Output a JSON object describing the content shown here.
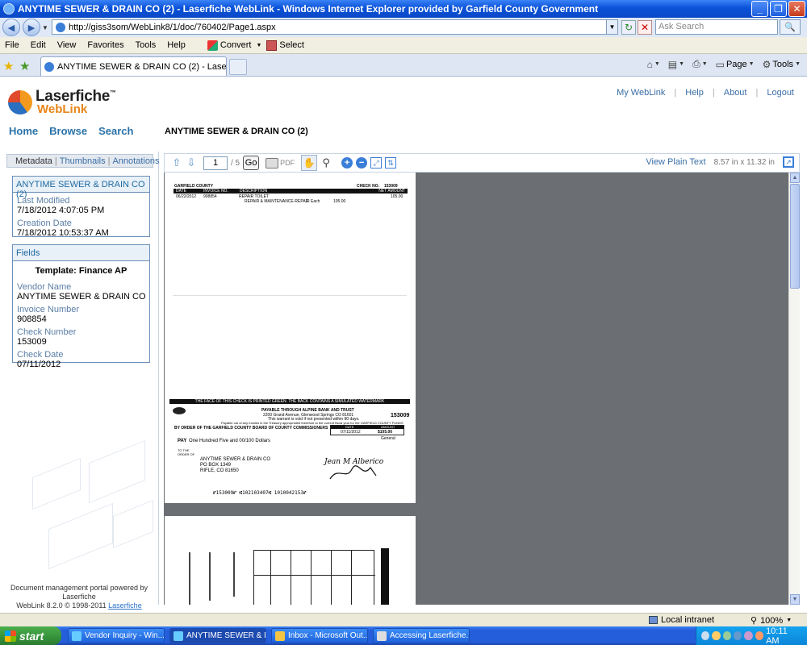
{
  "window": {
    "title": "ANYTIME SEWER & DRAIN CO (2) - Laserfiche WebLink - Windows Internet Explorer provided by Garfield County Government",
    "buttons": [
      "_",
      "❐",
      "✕"
    ]
  },
  "address_bar": {
    "url": "http://giss3som/WebLink8/1/doc/760402/Page1.aspx",
    "search_placeholder": "Ask Search"
  },
  "menu": {
    "items": [
      "File",
      "Edit",
      "View",
      "Favorites",
      "Tools",
      "Help"
    ],
    "convert_label": "Convert",
    "select_label": "Select"
  },
  "tabs": {
    "active_tab": "ANYTIME SEWER & DRAIN CO (2) - Laserfiche WebLink",
    "page_label": "Page",
    "tools_label": "Tools"
  },
  "weblink": {
    "brand": "Laserfiche",
    "sub_brand": "WebLink",
    "trademark": "™",
    "top_links": [
      "My WebLink",
      "Help",
      "About",
      "Logout"
    ],
    "nav": [
      "Home",
      "Browse",
      "Search"
    ],
    "doc_heading": "ANYTIME SEWER & DRAIN CO (2)"
  },
  "left_panel": {
    "tabs": [
      "Metadata",
      "Thumbnails",
      "Annotations"
    ],
    "info_box": {
      "title": "ANYTIME SEWER & DRAIN CO (2)",
      "last_modified_label": "Last Modified",
      "last_modified": "7/18/2012 4:07:05 PM",
      "creation_date_label": "Creation Date",
      "creation_date": "7/18/2012 10:53:37 AM"
    },
    "fields_box": {
      "title": "Fields",
      "template": "Template: Finance AP",
      "fields": [
        {
          "label": "Vendor Name",
          "value": "ANYTIME SEWER & DRAIN CO"
        },
        {
          "label": "Invoice Number",
          "value": "908854"
        },
        {
          "label": "Check Number",
          "value": "153009"
        },
        {
          "label": "Check Date",
          "value": "07/11/2012"
        }
      ]
    },
    "footer": {
      "line1": "Document management portal powered by Laserfiche",
      "line2": "WebLink 8.2.0 © 1998-2011",
      "link": "Laserfiche"
    }
  },
  "viewer": {
    "page_number": "1",
    "page_total": "/ 5",
    "go_label": "Go",
    "pdf_label": "PDF",
    "plain_text_link": "View Plain Text",
    "dimensions": "8.57 in x 11.32 in"
  },
  "check_doc": {
    "county": "GARFIELD COUNTY",
    "check_no_label": "CHECK NO.",
    "check_no": "153009",
    "col_date": "DATE",
    "col_invoice": "INVOICE NO.",
    "col_desc": "DESCRIPTION",
    "col_net": "NET AMOUNT",
    "row_date": "06/22/2012",
    "row_invoice": "908854",
    "row_desc": "REPAIR TOILET",
    "row_sub": "REPAIR & MAINTENANCE-REPAIR",
    "row_qty": "1",
    "row_unit": "Each",
    "row_unit_amount": "105.00",
    "row_net": "105.00",
    "green_banner": "THE FACE OF THIS CHECK IS PRINTED GREEN. THE BACK CONTAINS A SIMULATED WATERMARK",
    "payable_through": "PAYABLE THROUGH ALPINE BANK AND TRUST",
    "bank_address": "2200 Grand Avenue, Glenwood Springs CO 81601",
    "validity": "This warrant is void if not presented within 90 days.",
    "treasury_note": "Payable out of any monies in the Treasury appropriated therefore to the current fiscal year for the GARFIELD COUNTY FUNDS",
    "order_line": "BY ORDER OF THE GARFIELD COUNTY BOARD OF COUNTY COMMISSIONERS",
    "check_no_right": "153009",
    "date_label": "DATE",
    "amount_label": "AMOUNT",
    "check_date": "07/11/2012",
    "check_amount": "$105.00",
    "fund": "General",
    "pay_word": "PAY",
    "pay_text": "One Hundred Five and 00/100 Dollars",
    "to_the_order": "TO THE ORDER OF",
    "payee_name": "ANYTIME SEWER & DRAIN CO",
    "payee_po": "PO BOX 1349",
    "payee_city": "RIFLE, CO 81650",
    "micr": "⑈153009⑈ ⑆102103407⑆ 1010042153⑈",
    "signature": "Jean M Alberico"
  },
  "statusbar": {
    "zone": "Local intranet",
    "zoom": "100%"
  },
  "taskbar": {
    "start": "start",
    "tasks": [
      "Vendor Inquiry - Win...",
      "ANYTIME SEWER & D...",
      "Inbox - Microsoft Out...",
      "Accessing Laserfiche...."
    ],
    "clock": "10:11 AM"
  }
}
